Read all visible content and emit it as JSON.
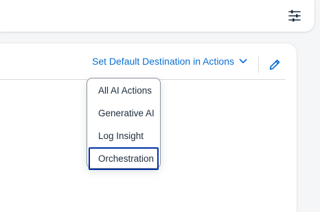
{
  "toolbar": {
    "filter_icon": "filter-settings-icon"
  },
  "card": {
    "destination_button_label": "Set Default Destination in Actions",
    "chevron_icon": "chevron-down-icon",
    "edit_icon": "edit-pencil-icon"
  },
  "menu": {
    "items": [
      {
        "label": "All AI Actions"
      },
      {
        "label": "Generative AI"
      },
      {
        "label": "Log Insight"
      },
      {
        "label": "Orchestration",
        "focused": true
      }
    ]
  },
  "colors": {
    "accent": "#0a6ed1",
    "text": "#1d2d3e",
    "focus_border": "#0032a5",
    "background": "#f5f6f7"
  }
}
